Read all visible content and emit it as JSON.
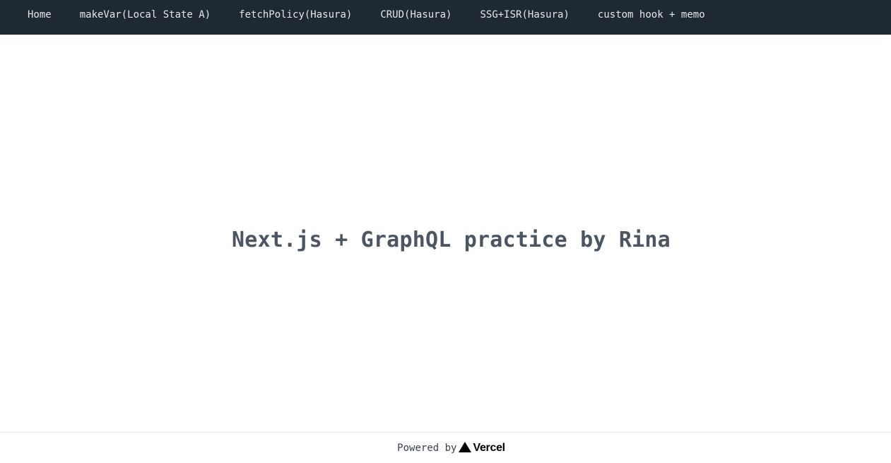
{
  "nav": {
    "items": [
      {
        "label": "Home"
      },
      {
        "label": "makeVar(Local State A)"
      },
      {
        "label": "fetchPolicy(Hasura)"
      },
      {
        "label": "CRUD(Hasura)"
      },
      {
        "label": "SSG+ISR(Hasura)"
      },
      {
        "label": "custom hook + memo"
      }
    ]
  },
  "main": {
    "title": "Next.js + GraphQL practice by Rina"
  },
  "footer": {
    "powered_label": "Powered by",
    "brand_icon": "vercel-triangle-icon",
    "brand_name": "Vercel"
  },
  "colors": {
    "nav_background": "#1f2933",
    "nav_text": "#e5e7eb",
    "title_text": "#4b5563",
    "footer_border": "#e5e7eb"
  }
}
